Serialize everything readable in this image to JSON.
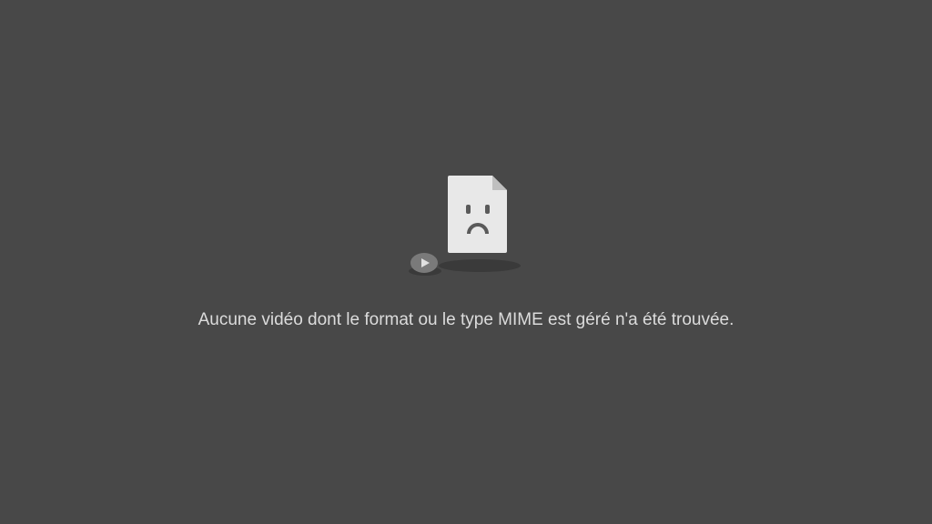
{
  "error": {
    "message": "Aucune vidéo dont le format ou le type MIME est géré n'a été trouvée."
  }
}
